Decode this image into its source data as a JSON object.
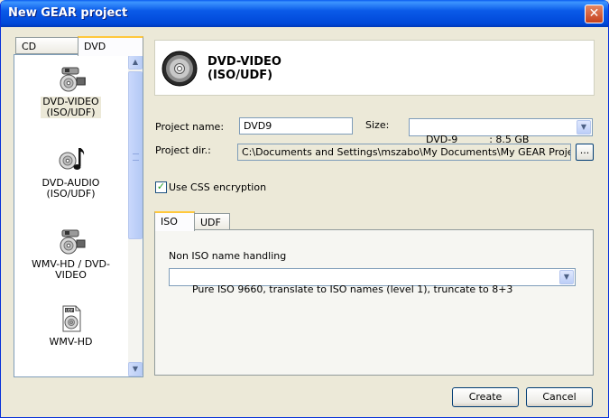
{
  "window": {
    "title": "New GEAR project"
  },
  "left_tabs": [
    {
      "label": "CD",
      "active": false
    },
    {
      "label": "DVD",
      "active": true
    }
  ],
  "projects": [
    {
      "line1": "DVD-VIDEO",
      "line2": "(ISO/UDF)",
      "icon": "dvd-video-camera-icon",
      "selected": true
    },
    {
      "line1": "DVD-AUDIO",
      "line2": "(ISO/UDF)",
      "icon": "dvd-audio-note-icon",
      "selected": false
    },
    {
      "line1": "WMV-HD / DVD-VIDEO",
      "line2": "",
      "icon": "wmv-hd-dvd-camera-icon",
      "selected": false
    },
    {
      "line1": "WMV-HD",
      "line2": "",
      "icon": "udf-document-disc-icon",
      "selected": false
    }
  ],
  "header": {
    "title_line1": "DVD-VIDEO",
    "title_line2": "(ISO/UDF)",
    "icon": "disc-icon"
  },
  "form": {
    "project_name_label": "Project name:",
    "project_name_value": "DVD9",
    "size_label": "Size:",
    "size_value": "DVD-9          : 8.5 GB",
    "project_dir_label": "Project dir.:",
    "project_dir_value": "C:\\Documents and Settings\\mszabo\\My Documents\\My GEAR Projects",
    "browse_label": "...",
    "css_label": "Use CSS encryption",
    "css_checked": true
  },
  "inner_tabs": [
    {
      "label": "ISO",
      "active": true
    },
    {
      "label": "UDF",
      "active": false
    }
  ],
  "iso": {
    "name_handling_label": "Non ISO name handling",
    "name_handling_value": "Pure ISO 9660, translate to ISO names (level 1), truncate to 8+3"
  },
  "buttons": {
    "create": "Create",
    "cancel": "Cancel"
  },
  "colors": {
    "titlebar": "#0a5ae8",
    "dialog_bg": "#ece9d8",
    "tab_highlight": "#ffc83c",
    "border": "#7f9db9"
  }
}
